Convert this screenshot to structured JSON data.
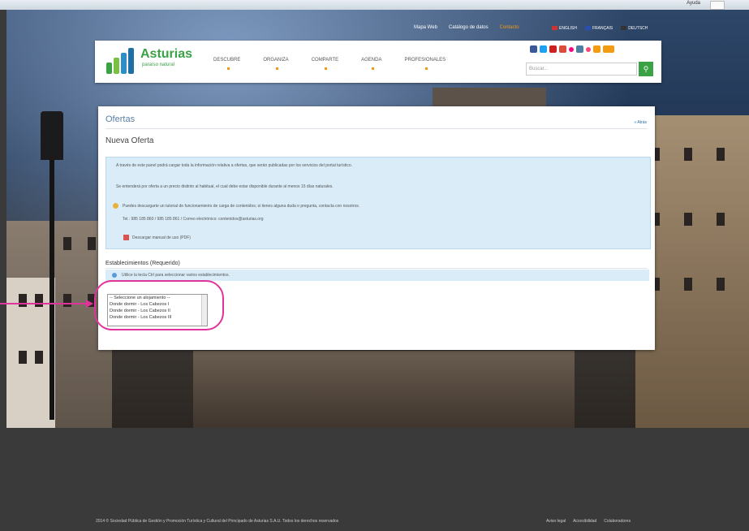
{
  "browser": {
    "address": "Ayuda"
  },
  "topnav": {
    "items": [
      "Mapa Web",
      "Catálogo de datos",
      "Contacto"
    ],
    "highlight_index": 2
  },
  "languages": [
    "ENGLISH",
    "FRANÇAIS",
    "DEUTSCH"
  ],
  "header": {
    "logo_title": "Asturias",
    "logo_subtitle": "paraíso natural",
    "nav": [
      "DESCUBRE",
      "ORGANIZA",
      "COMPARTE",
      "AGENDA",
      "PROFESIONALES"
    ],
    "search_placeholder": "Buscar...",
    "social_icons": [
      "facebook-icon",
      "twitter-icon",
      "youtube-icon",
      "google-plus-icon",
      "flickr-icon",
      "instagram-icon",
      "foursquare-icon",
      "rss-icon",
      "blog-icon"
    ]
  },
  "panel": {
    "title": "Ofertas",
    "back_link": "« Atrás",
    "subtitle": "Nueva Oferta",
    "info_1": "A través de este panel podrá cargar toda la información relativa a ofertas, que serán publicadas por los servicios del portal turístico.",
    "info_2": "Se entenderá por oferta a un precio distinto al habitual, el cual debe estar disponible durante al menos 15 días naturales.",
    "info_3": "Puedes descargarte un tutorial de funcionamiento de carga de contenidos; si tienes alguna duda o pregunta, contacta con nosotros.",
    "info_3b": "Tel.: 985 185 860 / 985 185 861 / Correo electrónico: contenidos@asturias.org",
    "pdf_link": "Descargar manual de uso (PDF)",
    "section_title": "Establecimientos (Requerido)",
    "section_info": "Utilice la tecla Ctrl para seleccionar varios establecimientos.",
    "listbox_options": [
      "-- Seleccione un alojamiento --",
      "Donde dormir - Los Cabezos I",
      "Donde dormir - Los Cabezos II",
      "Donde dormir - Los Cabezos III"
    ]
  },
  "footer": {
    "copyright": "2014 © Sociedad Pública de Gestión y Promoción Turística y Cultural del Principado de Asturias S.A.U. Todos los derechos reservados",
    "links": [
      "Aviso legal",
      "Accesibilidad",
      "Colaboradores"
    ]
  },
  "colors": {
    "accent_green": "#3aa144",
    "accent_orange": "#f39c12",
    "highlight": "#e0339b",
    "info_bg": "#d9ecf8"
  }
}
